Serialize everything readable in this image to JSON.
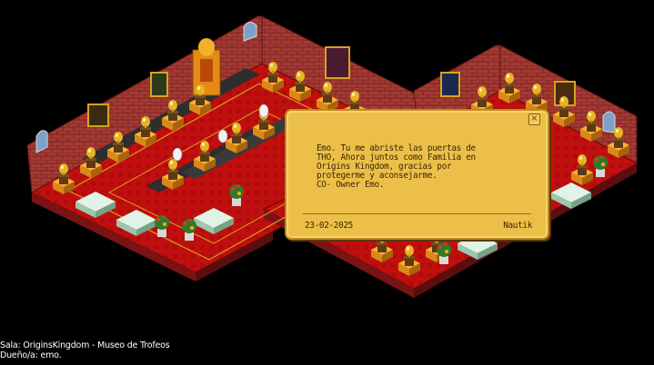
{
  "note": {
    "message": "Emo. Tu me abriste las puertas de\nTHO, Ahora juntos como Familia en\nOrigins Kingdom, gracias por\nprotegerme y aconsejarme.\n              CO- Owner Emo.",
    "date": "23-02-2025",
    "signature": "Nautik",
    "close_glyph": "×"
  },
  "room_info": {
    "name_line": "Sala: OriginsKingdom - Museo de Trofeos",
    "owner_line": "Dueño/a: emo."
  },
  "colors": {
    "background": "#000000",
    "note_paper": "#ecc048",
    "wall_brick": "#a83a32",
    "floor_carpet": "#c01010"
  }
}
